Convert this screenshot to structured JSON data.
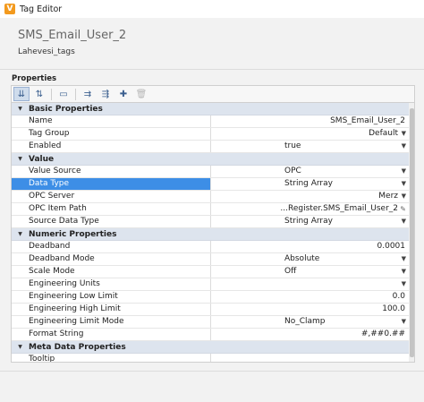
{
  "window": {
    "title": "Tag Editor",
    "icon_glyph": "V"
  },
  "header": {
    "tag_name": "SMS_Email_User_2",
    "tag_path": "Lahevesi_tags"
  },
  "properties_label": "Properties",
  "toolbar": {
    "buttons": [
      {
        "name": "sort-categorized-icon",
        "glyph": "⇊",
        "active": true
      },
      {
        "name": "sort-alphabetical-icon",
        "glyph": "⇅",
        "active": false
      },
      {
        "name": "property-pages-icon",
        "glyph": "▭",
        "active": false
      },
      {
        "name": "expand-all-icon",
        "glyph": "⇉",
        "active": false
      },
      {
        "name": "collapse-all-icon",
        "glyph": "⇶",
        "active": false
      },
      {
        "name": "add-property-icon",
        "glyph": "✚",
        "active": false
      },
      {
        "name": "delete-icon",
        "glyph": "🗑",
        "active": false,
        "disabled": true
      }
    ]
  },
  "grid": {
    "rows": [
      {
        "type": "category",
        "label": "Basic Properties"
      },
      {
        "type": "prop",
        "name": "Name",
        "value": "SMS_Email_User_2",
        "align": "right"
      },
      {
        "type": "prop",
        "name": "Tag Group",
        "value": "Default",
        "align": "right",
        "dropdown": true
      },
      {
        "type": "prop",
        "name": "Enabled",
        "value": "true",
        "align": "left",
        "dropdown": true
      },
      {
        "type": "category",
        "label": "Value"
      },
      {
        "type": "prop",
        "name": "Value Source",
        "value": "OPC",
        "align": "left",
        "dropdown": true
      },
      {
        "type": "prop",
        "name": "Data Type",
        "value": "String Array",
        "align": "left",
        "dropdown": true,
        "selected": true
      },
      {
        "type": "prop",
        "name": "OPC Server",
        "value": "Merz",
        "align": "right",
        "dropdown": true
      },
      {
        "type": "prop",
        "name": "OPC Item Path",
        "value": "...Register.SMS_Email_User_2",
        "align": "right",
        "edit": true
      },
      {
        "type": "prop",
        "name": "Source Data Type",
        "value": "String Array",
        "align": "left",
        "dropdown": true
      },
      {
        "type": "category",
        "label": "Numeric Properties"
      },
      {
        "type": "prop",
        "name": "Deadband",
        "value": "0.0001",
        "align": "right"
      },
      {
        "type": "prop",
        "name": "Deadband Mode",
        "value": "Absolute",
        "align": "left",
        "dropdown": true
      },
      {
        "type": "prop",
        "name": "Scale Mode",
        "value": "Off",
        "align": "left",
        "dropdown": true
      },
      {
        "type": "prop",
        "name": "Engineering Units",
        "value": "",
        "align": "left",
        "dropdown": true
      },
      {
        "type": "prop",
        "name": "Engineering Low Limit",
        "value": "0.0",
        "align": "right"
      },
      {
        "type": "prop",
        "name": "Engineering High Limit",
        "value": "100.0",
        "align": "right"
      },
      {
        "type": "prop",
        "name": "Engineering Limit Mode",
        "value": "No_Clamp",
        "align": "left",
        "dropdown": true
      },
      {
        "type": "prop",
        "name": "Format String",
        "value": "#,##0.##",
        "align": "right"
      },
      {
        "type": "category",
        "label": "Meta Data Properties"
      },
      {
        "type": "prop",
        "name": "Tooltip",
        "value": "",
        "align": "left"
      }
    ]
  },
  "colors": {
    "accent": "#f39a1e",
    "selection": "#3d8ee6",
    "category_bg": "#dde4ee"
  }
}
